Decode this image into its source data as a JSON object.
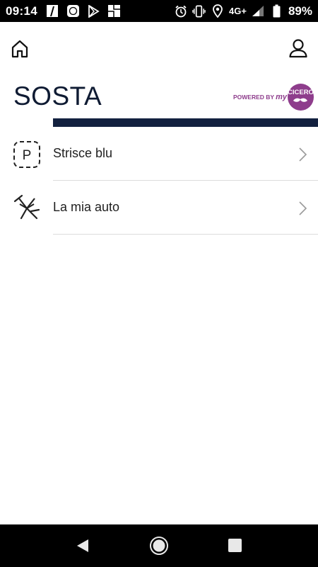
{
  "status_bar": {
    "time": "09:14",
    "network": "4G+",
    "battery": "89%",
    "icons_left": [
      "doc-icon",
      "app-icon",
      "play-store-icon",
      "gallery-icon"
    ],
    "icons_right": [
      "alarm-icon",
      "vibrate-icon",
      "location-icon",
      "signal-icon",
      "battery-icon"
    ]
  },
  "header": {
    "home_icon": "home-icon",
    "account_icon": "user-icon"
  },
  "page": {
    "title": "SOSTA",
    "powered_by": "POWERED BY",
    "brand_my": "my",
    "brand_name": "CICERO",
    "accent_color": "#13213f",
    "brand_color": "#8e3d8c"
  },
  "menu": {
    "items": [
      {
        "label": "Strisce blu",
        "icon": "parking-sign-icon"
      },
      {
        "label": "La mia auto",
        "icon": "parking-meter-icon"
      }
    ]
  },
  "nav_bar": {
    "back_icon": "back-triangle-icon",
    "home_icon": "home-circle-icon",
    "recents_icon": "recents-square-icon"
  }
}
